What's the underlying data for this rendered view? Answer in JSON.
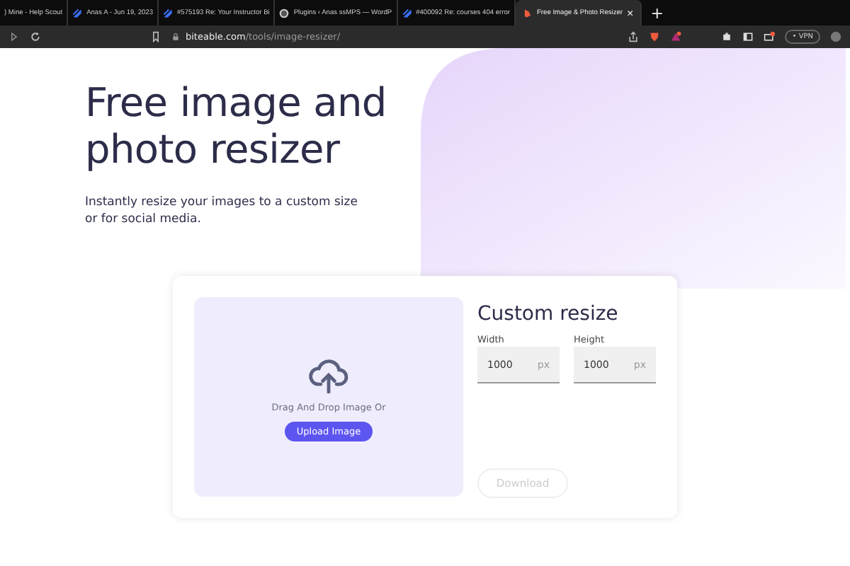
{
  "browser": {
    "tabs": [
      {
        "label": ") Mine - Help Scout",
        "kind": "plain",
        "selected": false
      },
      {
        "label": "Anas A - Jun 19, 2023",
        "kind": "ticket",
        "selected": false
      },
      {
        "label": "#575193 Re: Your Instructor Bi",
        "kind": "ticket",
        "selected": false
      },
      {
        "label": "Plugins ‹ Anas ssMPS — WordP",
        "kind": "wordpress",
        "selected": false
      },
      {
        "label": "#400092 Re: courses 404 error",
        "kind": "ticket",
        "selected": false
      },
      {
        "label": "Free Image & Photo Resizer",
        "kind": "site",
        "selected": true
      }
    ],
    "new_tab": "+",
    "close_tab": "×",
    "address": {
      "host": "biteable.com",
      "path": "/tools/image-resizer/"
    },
    "vpn": "• VPN"
  },
  "hero": {
    "title": "Free image and photo resizer",
    "subtitle": "Instantly resize your images to a custom size or for social media."
  },
  "drop_zone": {
    "prompt": "Drag And Drop Image Or",
    "button": "Upload Image"
  },
  "custom": {
    "title": "Custom resize",
    "fields": [
      {
        "label": "Width",
        "value": "1000",
        "unit": "px"
      },
      {
        "label": "Height",
        "value": "1000",
        "unit": "px"
      }
    ],
    "download": {
      "label": "Download",
      "disabled": true
    }
  }
}
